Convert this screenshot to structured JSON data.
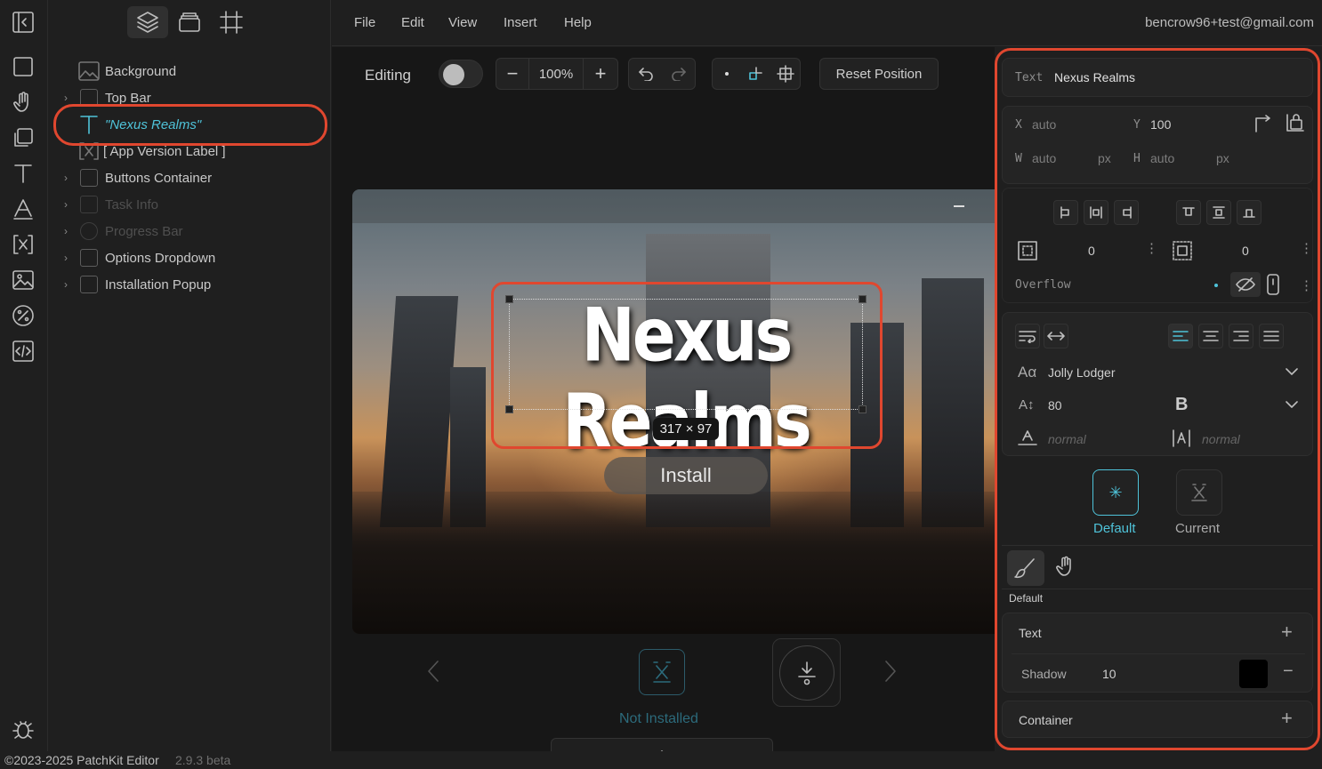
{
  "app": {
    "footer_copy": "©2023-2025 PatchKit Editor",
    "footer_version": "2.9.3 beta",
    "user_email": "bencrow96+test@gmail.com"
  },
  "menu": [
    "File",
    "Edit",
    "View",
    "Insert",
    "Help"
  ],
  "layers": [
    {
      "label": "Background",
      "type": "image"
    },
    {
      "label": "Top Bar",
      "type": "group"
    },
    {
      "label": "\"Nexus Realms\"",
      "type": "text",
      "selected": true
    },
    {
      "label": "[ App Version Label ]",
      "type": "variable"
    },
    {
      "label": "Buttons Container",
      "type": "group"
    },
    {
      "label": "Task Info",
      "type": "group",
      "dim": true
    },
    {
      "label": "Progress Bar",
      "type": "group",
      "dim": true
    },
    {
      "label": "Options Dropdown",
      "type": "group"
    },
    {
      "label": "Installation Popup",
      "type": "group"
    }
  ],
  "toolbar": {
    "editing_label": "Editing",
    "editing_on": false,
    "zoom": "100%",
    "reset_label": "Reset Position",
    "minus": "−",
    "plus": "+"
  },
  "preview": {
    "title": "Nexus Realms",
    "dims": "317 × 97",
    "install_label": "Install",
    "status": "Not Installed"
  },
  "panel": {
    "element_type": "Text",
    "element_name": "Nexus Realms",
    "x_label": "X",
    "x_value": "auto",
    "y_label": "Y",
    "y_value": "100",
    "w_label": "W",
    "w_value": "auto",
    "w_unit": "px",
    "h_label": "H",
    "h_value": "auto",
    "h_unit": "px",
    "margin": "0",
    "padding": "0",
    "overflow_label": "Overflow",
    "font": "Jolly Lodger",
    "font_size": "80",
    "bold": "B",
    "letter_spacing": "normal",
    "line_height": "normal",
    "states": [
      {
        "label": "Default",
        "active": true
      },
      {
        "label": "Current",
        "active": false
      }
    ],
    "style_state": "Default",
    "text_section": "Text",
    "shadow_label": "Shadow",
    "shadow_value": "10",
    "shadow_color": "#000000",
    "container_section": "Container"
  },
  "colors": {
    "accent": "#4fc3d9",
    "highlight": "#e0472f"
  }
}
